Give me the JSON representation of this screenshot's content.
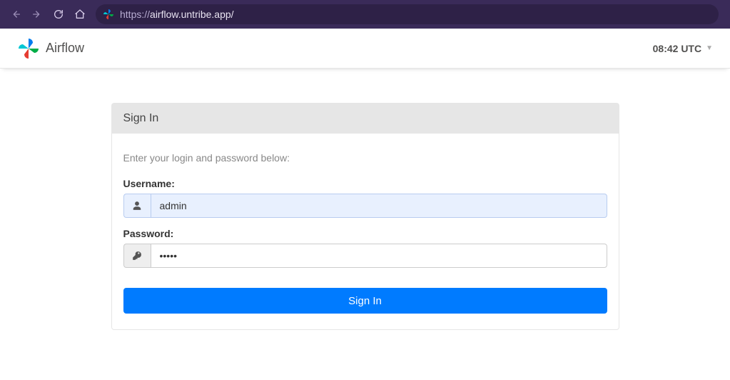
{
  "browser": {
    "url_scheme": "https://",
    "url_rest": "airflow.untribe.app/"
  },
  "header": {
    "brand": "Airflow",
    "time": "08:42 UTC"
  },
  "login": {
    "card_title": "Sign In",
    "help": "Enter your login and password below:",
    "username_label": "Username:",
    "username_value": "admin",
    "password_label": "Password:",
    "password_value": "•••••",
    "submit_label": "Sign In"
  }
}
